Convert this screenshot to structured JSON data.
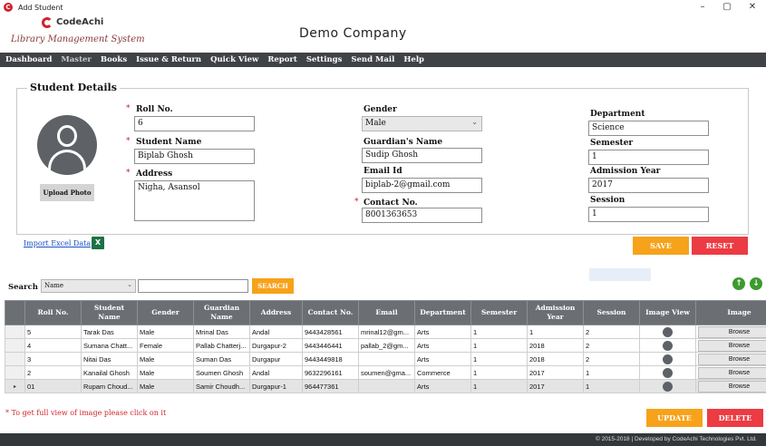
{
  "window": {
    "title": "Add Student",
    "minimize": "–",
    "maximize": "▢",
    "close": "✕"
  },
  "header": {
    "logo_text": "CodeAchi",
    "logo_subtitle": "Library Management System",
    "company": "Demo Company"
  },
  "menu": [
    "Dashboard",
    "Master",
    "Books",
    "Issue & Return",
    "Quick View",
    "Report",
    "Settings",
    "Send Mail",
    "Help"
  ],
  "menu_active": "Master",
  "form": {
    "title": "Student Details",
    "upload_label": "Upload Photo",
    "roll_label": "Roll No.",
    "roll_value": "6",
    "name_label": "Student Name",
    "name_value": "Biplab Ghosh",
    "address_label": "Address",
    "address_value": "Nigha, Asansol",
    "gender_label": "Gender",
    "gender_value": "Male",
    "guardian_label": "Guardian's Name",
    "guardian_value": "Sudip Ghosh",
    "email_label": "Email Id",
    "email_value": "biplab-2@gmail.com",
    "contact_label": "Contact No.",
    "contact_value": "8001363653",
    "department_label": "Department",
    "department_value": "Science",
    "semester_label": "Semester",
    "semester_value": "1",
    "admission_label": "Admission Year",
    "admission_value": "2017",
    "session_label": "Session",
    "session_value": "1",
    "required_mark": "*"
  },
  "actions": {
    "import_label": "Import Excel Data",
    "excel_icon_text": "X",
    "save": "SAVE",
    "reset": "RESET",
    "update": "UPDATE",
    "delete": "DELETE"
  },
  "search": {
    "label": "Search by",
    "field": "Name",
    "button": "SEARCH",
    "up_glyph": "↑",
    "down_glyph": "↓"
  },
  "table": {
    "columns": [
      "Roll No.",
      "Student Name",
      "Gender",
      "Guardian Name",
      "Address",
      "Contact No.",
      "Email",
      "Department",
      "Semester",
      "Admission Year",
      "Session",
      "Image View",
      "Image"
    ],
    "browse_label": "Browse",
    "selected_marker": "▸",
    "rows": [
      [
        "5",
        "Tarak Das",
        "Male",
        "Mrinal Das",
        "Andal",
        "9443428561",
        "mrinal12@gm...",
        "Arts",
        "1",
        "1",
        "2"
      ],
      [
        "4",
        "Sumana Chatt...",
        "Female",
        "Pallab Chatterj...",
        "Durgapur-2",
        "9443446441",
        "pallab_2@gm...",
        "Arts",
        "1",
        "2018",
        "2"
      ],
      [
        "3",
        "Nitai Das",
        "Male",
        "Suman Das",
        "Durgapur",
        "9443449818",
        "",
        "Arts",
        "1",
        "2018",
        "2"
      ],
      [
        "2",
        "Kanailal Ghosh",
        "Male",
        "Soumen Ghosh",
        "Andal",
        "9632296161",
        "soumen@gma...",
        "Commerce",
        "1",
        "2017",
        "1"
      ],
      [
        "01",
        "Rupam Choud...",
        "Male",
        "Samir Choudh...",
        "Durgapur-1",
        "964477361",
        "",
        "Arts",
        "1",
        "2017",
        "1"
      ]
    ]
  },
  "note": "* To get full view of image please click on it",
  "footer": "© 2015-2018 | Developed by CodeAchi Technologies Pvt. Ltd.",
  "colors": {
    "accent_orange": "#f7a21b",
    "accent_red": "#ec3b43",
    "menu_bg": "#3f4347",
    "table_header": "#6b6f73"
  }
}
